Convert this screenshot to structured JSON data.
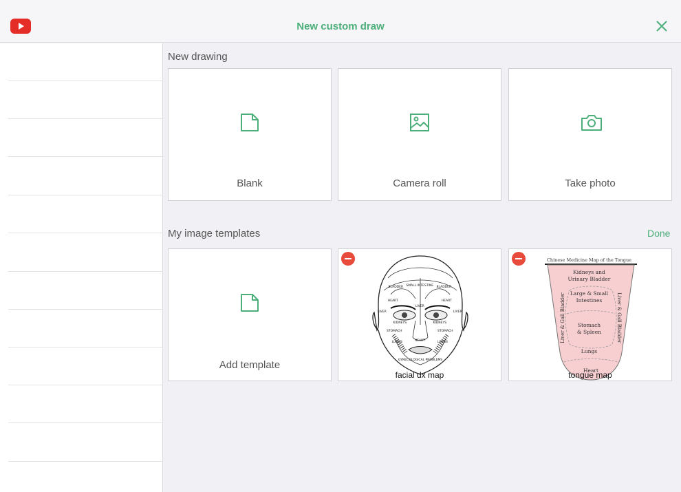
{
  "header": {
    "title": "New custom draw",
    "app_icon": "youtube-play-icon",
    "close_icon": "close-icon",
    "accent_color": "#4caf7a"
  },
  "new_drawing": {
    "section_label": "New drawing",
    "options": [
      {
        "label": "Blank",
        "icon": "blank-document-icon"
      },
      {
        "label": "Camera roll",
        "icon": "image-icon"
      },
      {
        "label": "Take photo",
        "icon": "camera-icon"
      }
    ]
  },
  "templates": {
    "section_label": "My image templates",
    "done_label": "Done",
    "add_label": "Add template",
    "items": [
      {
        "caption": "facial dx map",
        "texts": {
          "bladder_l": "BLADDER",
          "small_intestine": "SMALL\nINTESTINE",
          "bladder_r": "BLADDER",
          "heart_l": "HEART",
          "liver_c": "LIVER",
          "heart_r": "HEART",
          "liver_l": "LIVER",
          "liver_r": "LIVER",
          "kidneys_l": "KIDNEYS",
          "kidneys_r": "KIDNEYS",
          "stomach_l": "STOMACH",
          "stomach_r": "STOMACH",
          "lungs_l": "LUNGS",
          "heart_c": "HEART",
          "lungs_r": "LUNGS",
          "gyn": "GYNECOLOGICAL PROBLEMS"
        }
      },
      {
        "caption": "tongue map",
        "texts": {
          "title": "Chinese Medicine Map of the Tongue",
          "kidneys": "Kidneys and",
          "bladder": "Urinary Bladder",
          "large": "Large & Small",
          "intestines": "Intestines",
          "stomach": "Stomach",
          "spleen": "& Spleen",
          "lungs": "Lungs",
          "heart": "Heart",
          "liver_l": "Liver & Gall Bladder",
          "liver_r": "Liver & Gall Bladder"
        }
      }
    ]
  }
}
